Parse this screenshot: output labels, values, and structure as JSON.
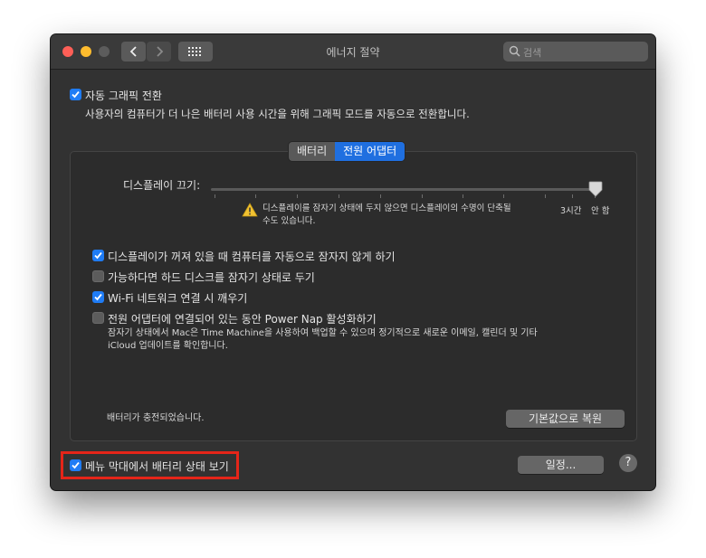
{
  "window": {
    "title": "에너지 절약"
  },
  "search": {
    "placeholder": "검색"
  },
  "auto_graphics": {
    "label": "자동 그래픽 전환",
    "checked": true,
    "description": "사용자의 컴퓨터가 더 나은 배터리 사용 시간을 위해 그래픽 모드를 자동으로 전환합니다."
  },
  "tabs": [
    {
      "label": "배터리",
      "active": false
    },
    {
      "label": "전원 어댑터",
      "active": true
    }
  ],
  "display_sleep": {
    "label": "디스플레이 끄기:",
    "warning": "디스플레이를 잠자기 상태에 두지 않으면 디스플레이의 수명이 단축될",
    "warning_line2": "수도 있습니다.",
    "tick_3h": "3시간",
    "tick_never": "안 함",
    "value": "안 함"
  },
  "options": [
    {
      "label": "디스플레이가 꺼져 있을 때 컴퓨터를 자동으로 잠자지 않게 하기",
      "checked": true
    },
    {
      "label": "가능하다면 하드 디스크를 잠자기 상태로 두기",
      "checked": false
    },
    {
      "label": "Wi-Fi 네트워크 연결 시 깨우기",
      "checked": true
    },
    {
      "label": "전원 어댑터에 연결되어 있는 동안 Power Nap 활성화하기",
      "checked": false
    }
  ],
  "power_nap_desc_1": "잠자기 상태에서 Mac은 Time Machine을 사용하여 백업할 수 있으며 정기적으로 새로운 이메일, 캘린더 및 기타",
  "power_nap_desc_2": "iCloud 업데이트를 확인합니다.",
  "battery_status": "배터리가 충전되었습니다.",
  "restore_defaults": "기본값으로 복원",
  "menu_bar_battery": {
    "label": "메뉴 막대에서 배터리 상태 보기",
    "checked": true
  },
  "schedule_button": "일정...",
  "help": "?",
  "colors": {
    "accent": "#1f7cf5",
    "highlight": "#e52519",
    "window_bg": "#323232"
  }
}
